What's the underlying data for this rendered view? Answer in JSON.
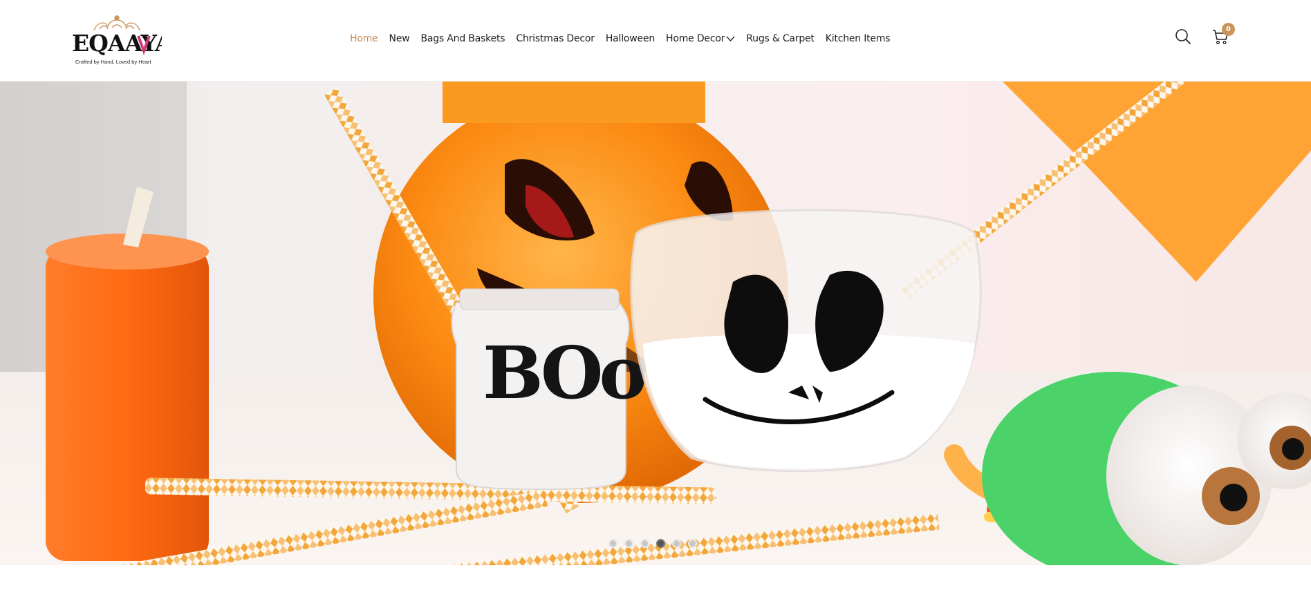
{
  "logo": {
    "brand_text": "EQAAYA",
    "tagline": "Crafted by Hand, Loved by Heart",
    "accent_color": "#d13b7b",
    "gold_color": "#c9955a"
  },
  "nav": {
    "items": [
      {
        "label": "Home",
        "active": true
      },
      {
        "label": "New"
      },
      {
        "label": "Bags And Baskets"
      },
      {
        "label": "Christmas Decor"
      },
      {
        "label": "Halloween"
      },
      {
        "label": "Home Decor",
        "has_dropdown": true
      },
      {
        "label": "Rugs & Carpet"
      },
      {
        "label": "Kitchen Items"
      }
    ],
    "active_color": "#c98a52"
  },
  "tools": {
    "search_icon": "search-icon",
    "cart_icon": "cart-icon",
    "cart_count": "0"
  },
  "hero": {
    "jar_text": "BOo",
    "slides_total": 6,
    "active_slide": 4
  }
}
